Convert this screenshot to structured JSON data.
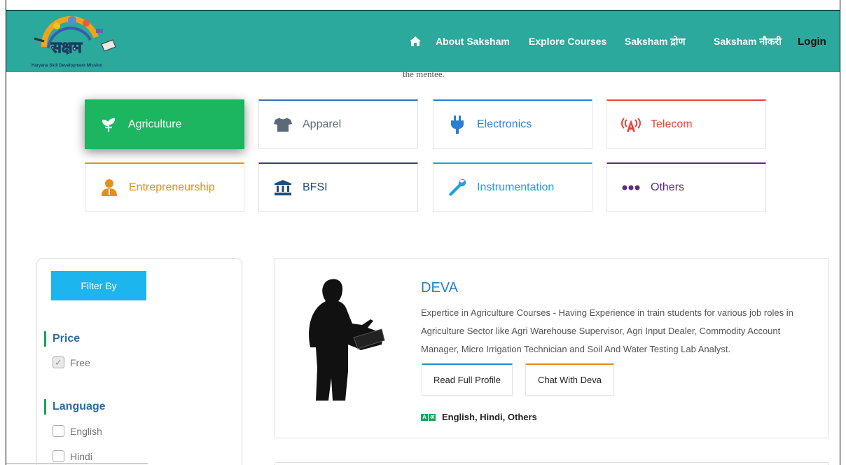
{
  "header": {
    "logo_text": "सक्षम",
    "logo_subtitle": "Haryana Skill Development Mission",
    "nav": {
      "about": "About Saksham",
      "explore": "Explore Courses",
      "drona": "Saksham द्रोण",
      "naukri": "Saksham नौकरी",
      "login": "Login"
    },
    "home_icon": "home-icon",
    "bg_color": "#2ba99c"
  },
  "truncated_text": "the mentee.",
  "categories": [
    {
      "label": "Agriculture",
      "icon": "plant-icon",
      "color": "#1bb65f",
      "active": true
    },
    {
      "label": "Apparel",
      "icon": "tshirt-icon",
      "color": "#5a6a7a"
    },
    {
      "label": "Electronics",
      "icon": "plug-icon",
      "color": "#2a7fd0"
    },
    {
      "label": "Telecom",
      "icon": "antenna-icon",
      "color": "#e8403a"
    },
    {
      "label": "Entrepreneurship",
      "icon": "person-icon",
      "color": "#e2901a"
    },
    {
      "label": "BFSI",
      "icon": "bank-icon",
      "color": "#1f4e79"
    },
    {
      "label": "Instrumentation",
      "icon": "wrench-icon",
      "color": "#1aa3de"
    },
    {
      "label": "Others",
      "icon": "dots-icon",
      "color": "#5b2a86"
    }
  ],
  "sidebar": {
    "filter_label": "Filter By",
    "price_title": "Price",
    "price_options": [
      {
        "label": "Free",
        "checked": true
      }
    ],
    "language_title": "Language",
    "language_options": [
      {
        "label": "English",
        "checked": false
      },
      {
        "label": "Hindi",
        "checked": false
      }
    ]
  },
  "mentor": {
    "name": "DEVA",
    "description": "Expertice in Agriculture Courses - Having Experience in train students for various job roles in Agriculture Sector like Agri Warehouse Supervisor, Agri Input Dealer, Commodity Account Manager, Micro Irrigation Technician and Soil And Water Testing Lab Analyst.",
    "profile_button": "Read Full Profile",
    "chat_button": "Chat With Deva",
    "languages": "English, Hindi, Others",
    "lang_icon_letters": [
      "A",
      "अ"
    ]
  }
}
